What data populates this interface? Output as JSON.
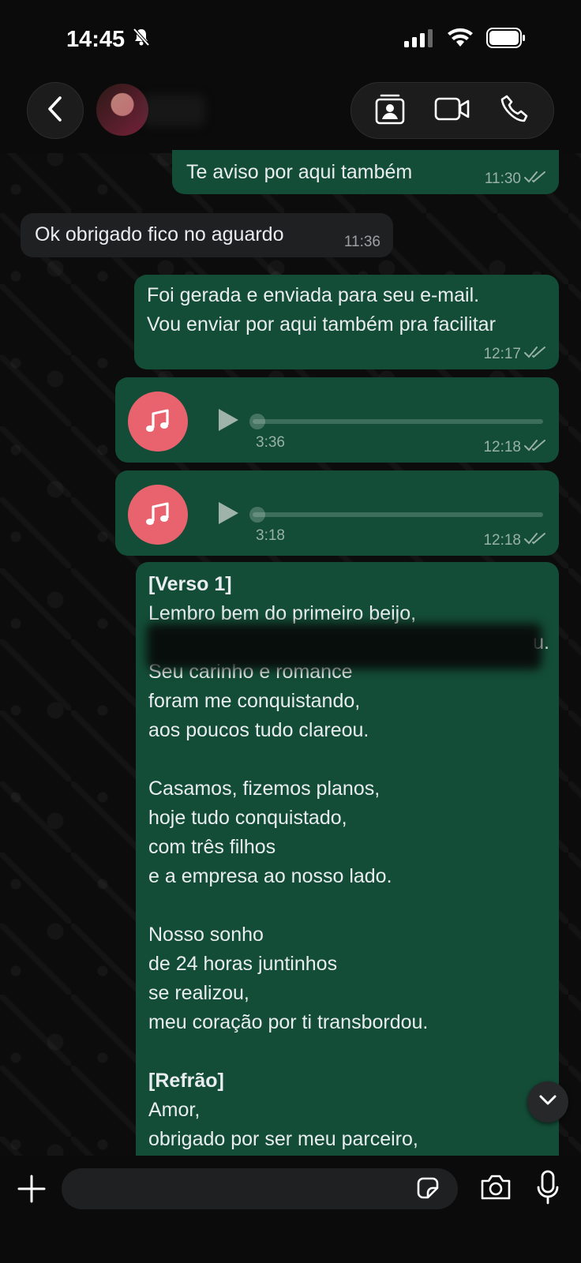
{
  "status_bar": {
    "time": "14:45"
  },
  "composer": {
    "placeholder": ""
  },
  "messages": [
    {
      "text": "Te aviso por aqui também",
      "time": "11:30"
    },
    {
      "text": "Ok obrigado fico no aguardo",
      "time": "11:36"
    },
    {
      "text": "Foi gerada e enviada para seu e-mail.\nVou enviar por aqui também pra facilitar",
      "time": "12:17"
    },
    {
      "duration": "3:36",
      "time": "12:18"
    },
    {
      "duration": "3:18",
      "time": "12:18"
    }
  ],
  "lyrics": {
    "lines": [
      "[Verso 1]",
      "Lembro bem do primeiro beijo,",
      "u.",
      "Seu carinho e romance",
      "foram me conquistando,",
      "aos poucos tudo clareou.",
      "",
      "Casamos, fizemos planos,",
      "hoje tudo conquistado,",
      "com três filhos",
      "e a empresa ao nosso lado.",
      "",
      "Nosso sonho",
      "de 24 horas juntinhos",
      "se realizou,",
      "meu coração por ti transbordou.",
      "",
      "[Refrão]",
      "Amor,",
      "obrigado por ser meu parceiro,"
    ]
  },
  "colors": {
    "outgoing_bubble": "#134d37",
    "incoming_bubble": "#1f2022",
    "audio_icon": "#e8636e"
  }
}
